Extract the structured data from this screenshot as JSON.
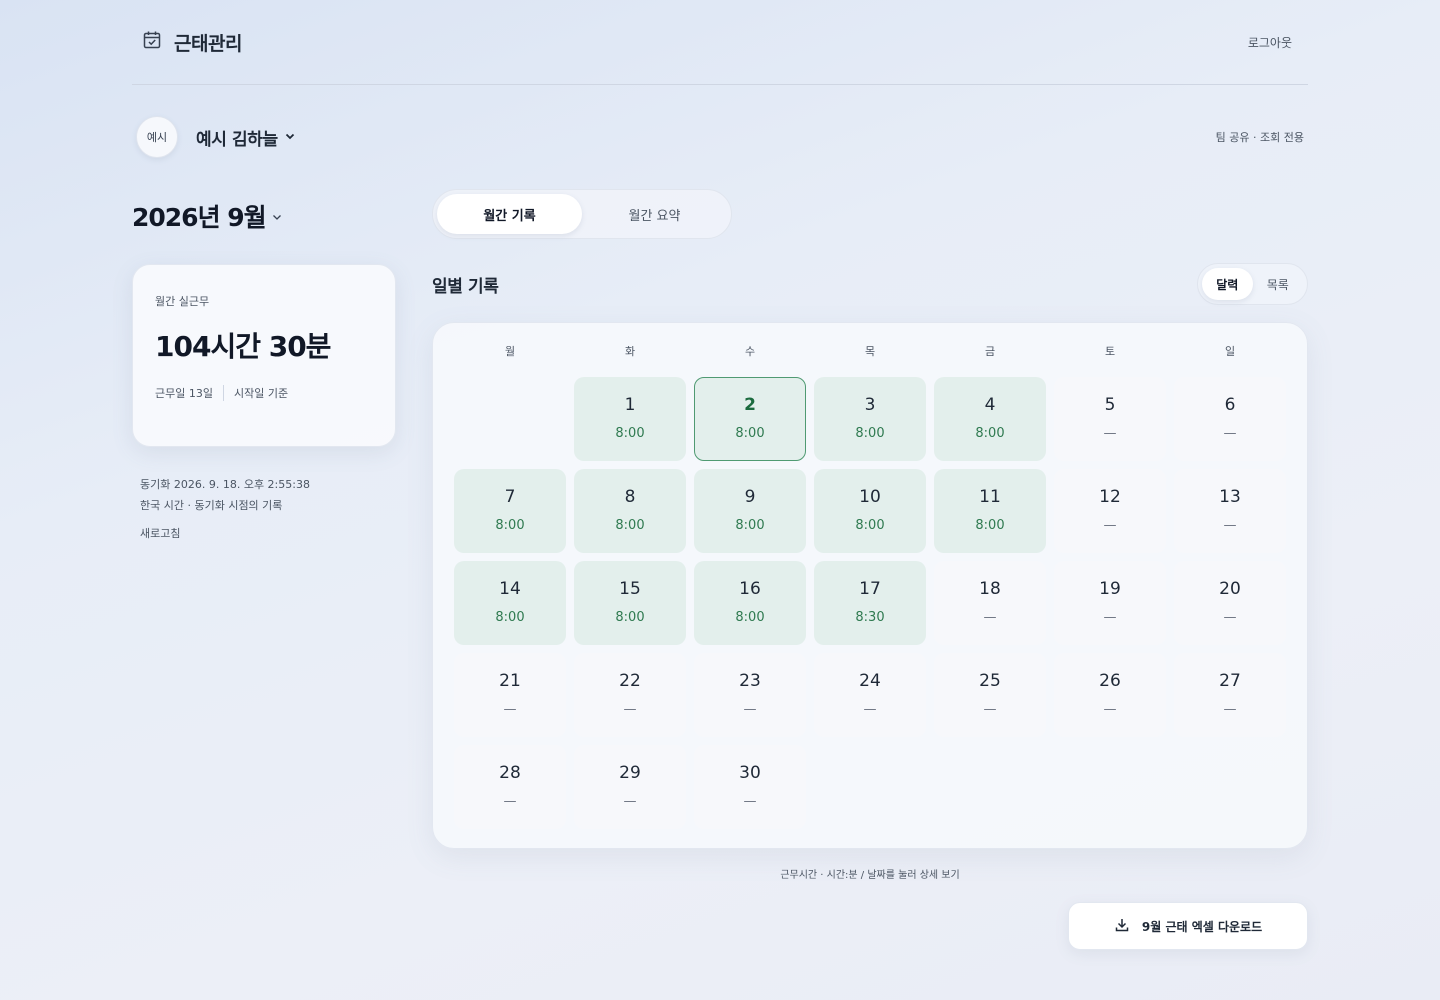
{
  "header": {
    "app_title": "근태관리",
    "logout_label": "로그아웃"
  },
  "user": {
    "avatar_text": "예시",
    "name": "예시 김하늘",
    "team_note": "팀 공유 · 조회 전용"
  },
  "month": {
    "title": "2026년 9월"
  },
  "summary": {
    "label": "월간 실근무",
    "value": "104시간 30분",
    "work_days": "근무일 13일",
    "basis": "시작일 기준"
  },
  "sync": {
    "line1": "동기화 2026. 9. 18. 오후 2:55:38",
    "line2": "한국 시간 · 동기화 시점의 기록",
    "refresh_label": "새로고침"
  },
  "tabs": {
    "records": "월간 기록",
    "summary": "월간 요약",
    "active": "records"
  },
  "section": {
    "title": "일별 기록",
    "view_calendar": "달력",
    "view_list": "목록",
    "active_view": "calendar"
  },
  "calendar": {
    "weekdays": [
      "월",
      "화",
      "수",
      "목",
      "금",
      "토",
      "일"
    ],
    "leading_blanks": 1,
    "today": 2,
    "days": [
      {
        "day": "1",
        "value": "8:00"
      },
      {
        "day": "2",
        "value": "8:00"
      },
      {
        "day": "3",
        "value": "8:00"
      },
      {
        "day": "4",
        "value": "8:00"
      },
      {
        "day": "5",
        "value": "—"
      },
      {
        "day": "6",
        "value": "—"
      },
      {
        "day": "7",
        "value": "8:00"
      },
      {
        "day": "8",
        "value": "8:00"
      },
      {
        "day": "9",
        "value": "8:00"
      },
      {
        "day": "10",
        "value": "8:00"
      },
      {
        "day": "11",
        "value": "8:00"
      },
      {
        "day": "12",
        "value": "—"
      },
      {
        "day": "13",
        "value": "—"
      },
      {
        "day": "14",
        "value": "8:00"
      },
      {
        "day": "15",
        "value": "8:00"
      },
      {
        "day": "16",
        "value": "8:00"
      },
      {
        "day": "17",
        "value": "8:30"
      },
      {
        "day": "18",
        "value": "—"
      },
      {
        "day": "19",
        "value": "—"
      },
      {
        "day": "20",
        "value": "—"
      },
      {
        "day": "21",
        "value": "—"
      },
      {
        "day": "22",
        "value": "—"
      },
      {
        "day": "23",
        "value": "—"
      },
      {
        "day": "24",
        "value": "—"
      },
      {
        "day": "25",
        "value": "—"
      },
      {
        "day": "26",
        "value": "—"
      },
      {
        "day": "27",
        "value": "—"
      },
      {
        "day": "28",
        "value": "—"
      },
      {
        "day": "29",
        "value": "—"
      },
      {
        "day": "30",
        "value": "—"
      }
    ]
  },
  "footnote": "근무시간 · 시간:분 / 날짜를 눌러 상세 보기",
  "download_label": "9월 근태 엑셀 다운로드",
  "colors": {
    "work_cell": "#e3efec",
    "work_text": "#2f7a50",
    "today_border": "#4f9a72",
    "off_cell": "#f7f8fb"
  }
}
